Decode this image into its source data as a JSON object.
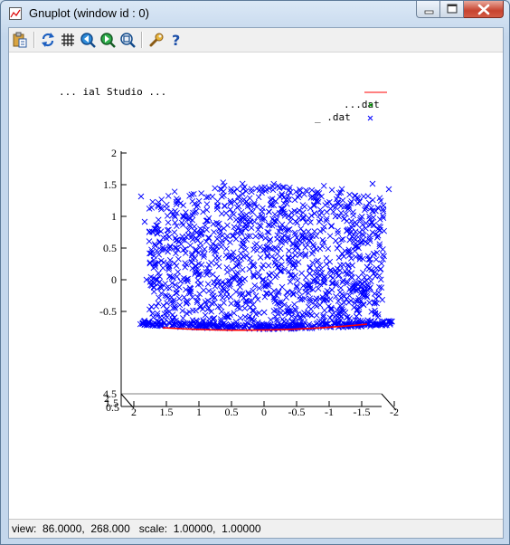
{
  "window": {
    "title": "Gnuplot (window id : 0)"
  },
  "toolbar": {
    "buttons": [
      "copy-clipboard",
      "replot",
      "grid",
      "zoom-previous",
      "zoom-next",
      "unzoom",
      "options",
      "help"
    ]
  },
  "plot": {
    "legend": [
      {
        "label": "... ial Studio ...",
        "color": "#ff0000"
      },
      {
        "label": "...dat",
        "color": "#00a000"
      },
      {
        "label": "_ .dat",
        "color": "#0000ff"
      }
    ]
  },
  "chart_data": {
    "type": "scatter",
    "view": "3d",
    "zlabels": [
      "2",
      "1.5",
      "1",
      "0.5",
      "0",
      "-0.5"
    ],
    "zlim": [
      -0.5,
      2
    ],
    "xlabels": [
      "2",
      "1.5",
      "1",
      "0.5",
      "0",
      "-0.5",
      "-1",
      "-1.5",
      "-2"
    ],
    "xlim": [
      2,
      -2
    ],
    "depth_labels": [
      "4.5",
      "2",
      "1.5",
      "0.5"
    ],
    "series": [
      {
        "color": "#ff0000",
        "marker": "line"
      },
      {
        "color": "#00a000",
        "marker": "plus"
      },
      {
        "color": "#0000ff",
        "marker": "x"
      }
    ]
  },
  "status": {
    "text": "view:  86.0000,  268.000   scale:  1.00000,  1.00000"
  }
}
